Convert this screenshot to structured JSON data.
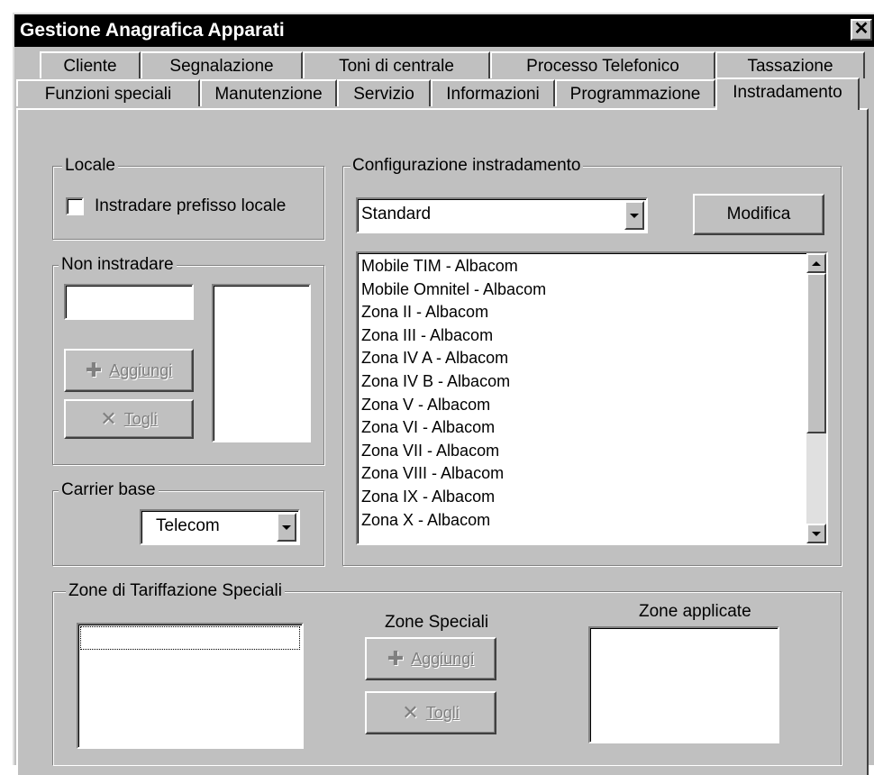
{
  "window": {
    "title": "Gestione Anagrafica Apparati",
    "close_glyph": "✕"
  },
  "tabs_row1": [
    "Cliente",
    "Segnalazione",
    "Toni di centrale",
    "Processo Telefonico",
    "Tassazione"
  ],
  "tabs_row2": [
    "Funzioni speciali",
    "Manutenzione",
    "Servizio",
    "Informazioni",
    "Programmazione",
    "Instradamento"
  ],
  "active_tab": "Instradamento",
  "locale": {
    "legend": "Locale",
    "checkbox_label": "Instradare prefisso locale",
    "checked": false
  },
  "non_instradare": {
    "legend": "Non instradare",
    "input_value": "",
    "add_label": "Aggiungi",
    "add_icon": "plus-icon",
    "remove_label": "Togli",
    "remove_icon": "x-icon"
  },
  "carrier": {
    "legend": "Carrier base",
    "selected": "Telecom"
  },
  "config": {
    "legend": "Configurazione instradamento",
    "selected": "Standard",
    "modify_label": "Modifica",
    "items": [
      "Mobile TIM - Albacom",
      "Mobile Omnitel - Albacom",
      "Zona II - Albacom",
      "Zona III - Albacom",
      "Zona IV A - Albacom",
      "Zona IV B - Albacom",
      "Zona V - Albacom",
      "Zona VI - Albacom",
      "Zona VII - Albacom",
      "Zona VIII - Albacom",
      "Zona IX - Albacom",
      "Zona X - Albacom"
    ]
  },
  "zone_speciali": {
    "legend": "Zone di Tariffazione Speciali",
    "middle_label": "Zone Speciali",
    "applied_label": "Zone applicate",
    "add_label": "Aggiungi",
    "remove_label": "Togli"
  }
}
